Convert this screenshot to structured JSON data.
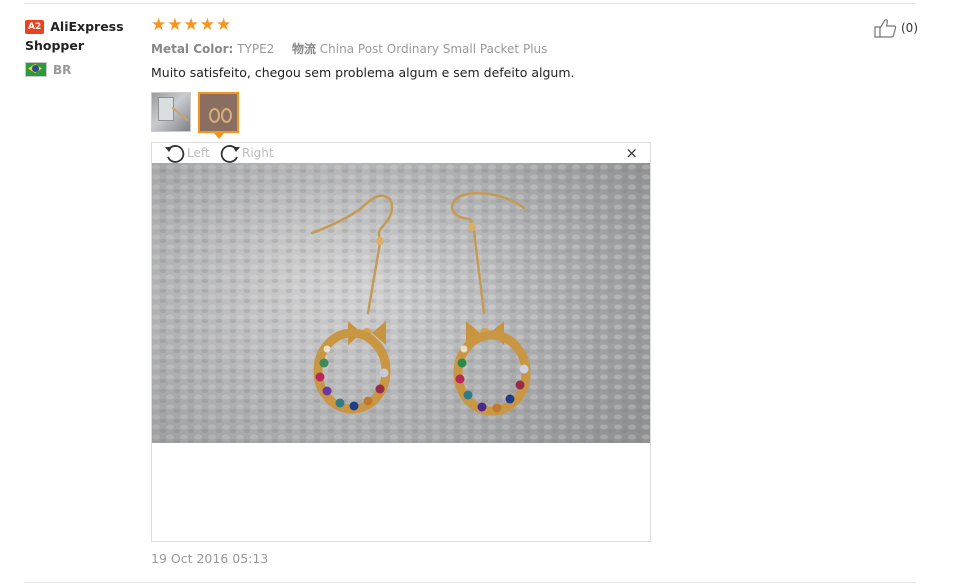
{
  "reviewer": {
    "badge": "A2",
    "name": "AliExpress Shopper",
    "country_code": "BR"
  },
  "review": {
    "rating": 5,
    "stars": [
      "★",
      "★",
      "★",
      "★",
      "★"
    ],
    "attribute_label": "Metal Color:",
    "attribute_value": "TYPE2",
    "shipping_label": "物流",
    "shipping_value": "China Post Ordinary Small Packet Plus",
    "comment": "Muito satisfeito, chegou sem problema algum e sem defeito algum.",
    "date": "19 Oct 2016 05:13"
  },
  "helpful": {
    "count": "(0)"
  },
  "viewer": {
    "rotate_left_label": "Left",
    "rotate_right_label": "Right",
    "close_glyph": "×"
  },
  "colors": {
    "accent": "#f7941e",
    "badge": "#e8431e",
    "muted": "#999999"
  }
}
